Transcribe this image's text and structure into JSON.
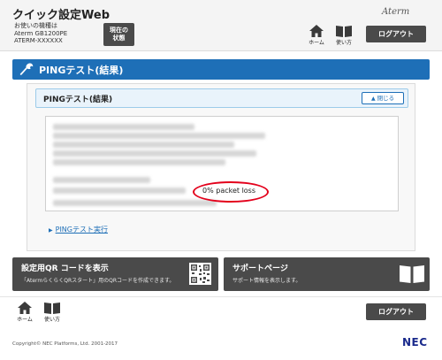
{
  "header": {
    "app_title": "クイック設定Web",
    "device_info_label": "お使いの機種は",
    "device_model": "Aterm GB1200PE",
    "device_ssid": "ATERM-XXXXXX",
    "status_button_line1": "現在の",
    "status_button_line2": "状態",
    "brand": "Aterm",
    "home_label": "ホーム",
    "help_label": "使い方",
    "logout_label": "ログアウト"
  },
  "title_bar": {
    "title": "PINGテスト(結果)",
    "icon": "wrench-icon"
  },
  "section": {
    "title": "PINGテスト(結果)",
    "collapse_label": "閉じる",
    "result_visible_text": "0% packet loss"
  },
  "links": {
    "ping_run": "PINGテスト実行"
  },
  "cards": [
    {
      "title": "設定用QR コードを表示",
      "description": "「AtermらくらくQRスタート」用のQRコードを作成できます。",
      "icon": "qr-code-icon"
    },
    {
      "title": "サポートページ",
      "description": "サポート情報を表示します。",
      "icon": "book-icon"
    }
  ],
  "footer": {
    "home_label": "ホーム",
    "help_label": "使い方",
    "logout_label": "ログアウト",
    "copyright": "Copyright© NEC Platforms, Ltd. 2001-2017",
    "logo": "NEC"
  },
  "colors": {
    "accent_blue": "#1e6fb7",
    "dark_button": "#4a4a4a",
    "highlight_red": "#e3001b",
    "nec_blue": "#1a2a8c"
  }
}
